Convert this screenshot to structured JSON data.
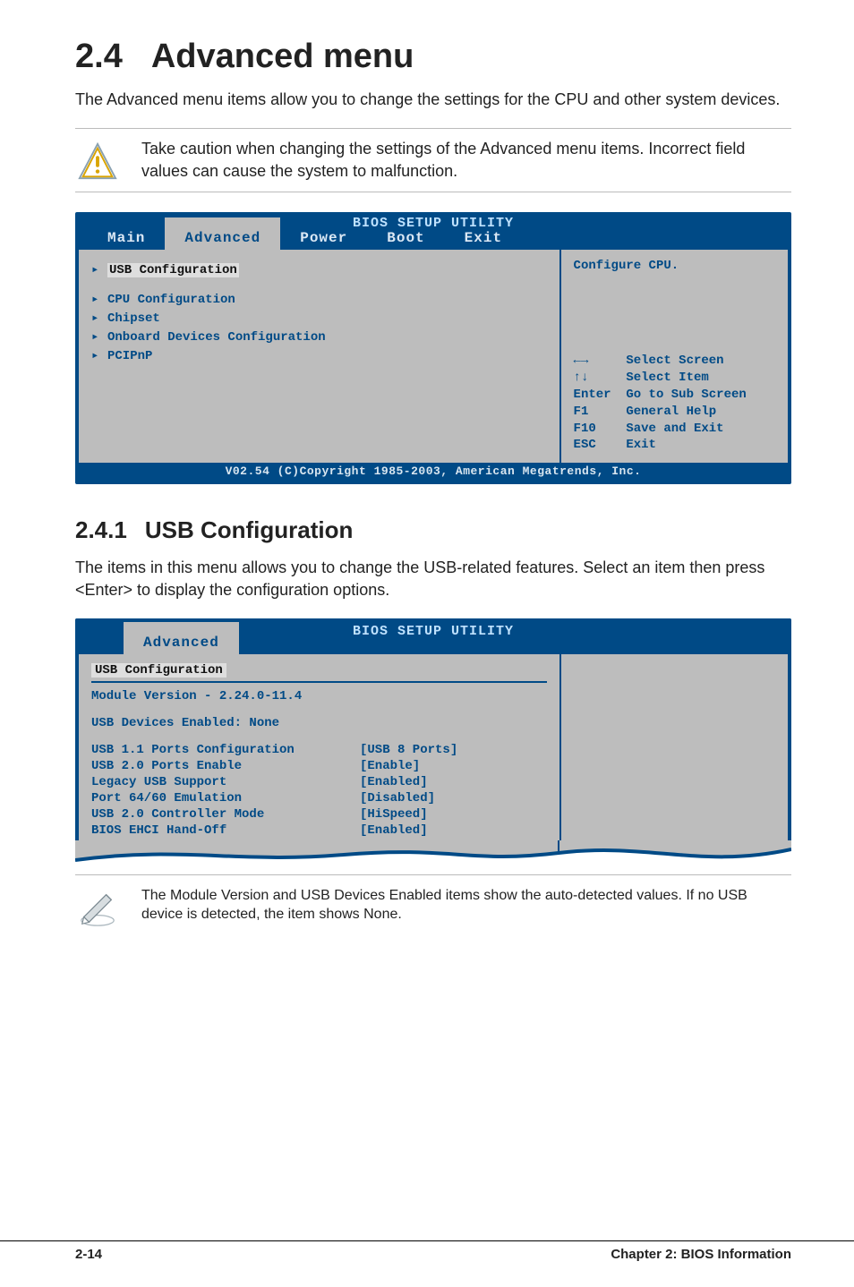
{
  "heading": {
    "number": "2.4",
    "title": "Advanced menu"
  },
  "intro": "The Advanced menu items allow you to change the settings for the CPU and other system devices.",
  "warning": "Take caution when changing the settings of the Advanced menu items. Incorrect field values can cause the system to malfunction.",
  "bios1": {
    "utility_title": "BIOS SETUP UTILITY",
    "tabs": [
      "Main",
      "Advanced",
      "Power",
      "Boot",
      "Exit"
    ],
    "active_tab_index": 1,
    "menu": [
      "USB Configuration",
      "CPU Configuration",
      "Chipset",
      "Onboard Devices Configuration",
      "PCIPnP"
    ],
    "highlight_index": 0,
    "help_text": "Configure CPU.",
    "legend": [
      {
        "key": "←→",
        "label": "Select Screen"
      },
      {
        "key": "↑↓",
        "label": "Select Item"
      },
      {
        "key": "Enter",
        "label": "Go to Sub Screen"
      },
      {
        "key": "F1",
        "label": "General Help"
      },
      {
        "key": "F10",
        "label": "Save and Exit"
      },
      {
        "key": "ESC",
        "label": "Exit"
      }
    ],
    "footer": "V02.54 (C)Copyright 1985-2003, American Megatrends, Inc."
  },
  "subheading": {
    "number": "2.4.1",
    "title": "USB Configuration"
  },
  "sub_intro": "The items in this menu allows you to change the USB-related features. Select an item then press <Enter> to display the configuration options.",
  "bios2": {
    "utility_title": "BIOS SETUP UTILITY",
    "active_tab": "Advanced",
    "section_title": "USB Configuration",
    "module_line": "Module Version - 2.24.0-11.4",
    "devices_line": "USB Devices Enabled: None",
    "rows": [
      {
        "label": "USB 1.1 Ports Configuration",
        "value": "[USB 8 Ports]"
      },
      {
        "label": "USB 2.0 Ports Enable",
        "value": "[Enable]"
      },
      {
        "label": "Legacy USB Support",
        "value": "[Enabled]"
      },
      {
        "label": "Port 64/60 Emulation",
        "value": "[Disabled]"
      },
      {
        "label": "USB 2.0 Controller Mode",
        "value": "[HiSpeed]"
      },
      {
        "label": "BIOS EHCI Hand-Off",
        "value": "[Enabled]"
      }
    ]
  },
  "note": "The Module Version and USB Devices Enabled items show the auto-detected values. If no USB device is detected, the item shows None.",
  "footer": {
    "page": "2-14",
    "chapter": "Chapter 2: BIOS Information"
  }
}
